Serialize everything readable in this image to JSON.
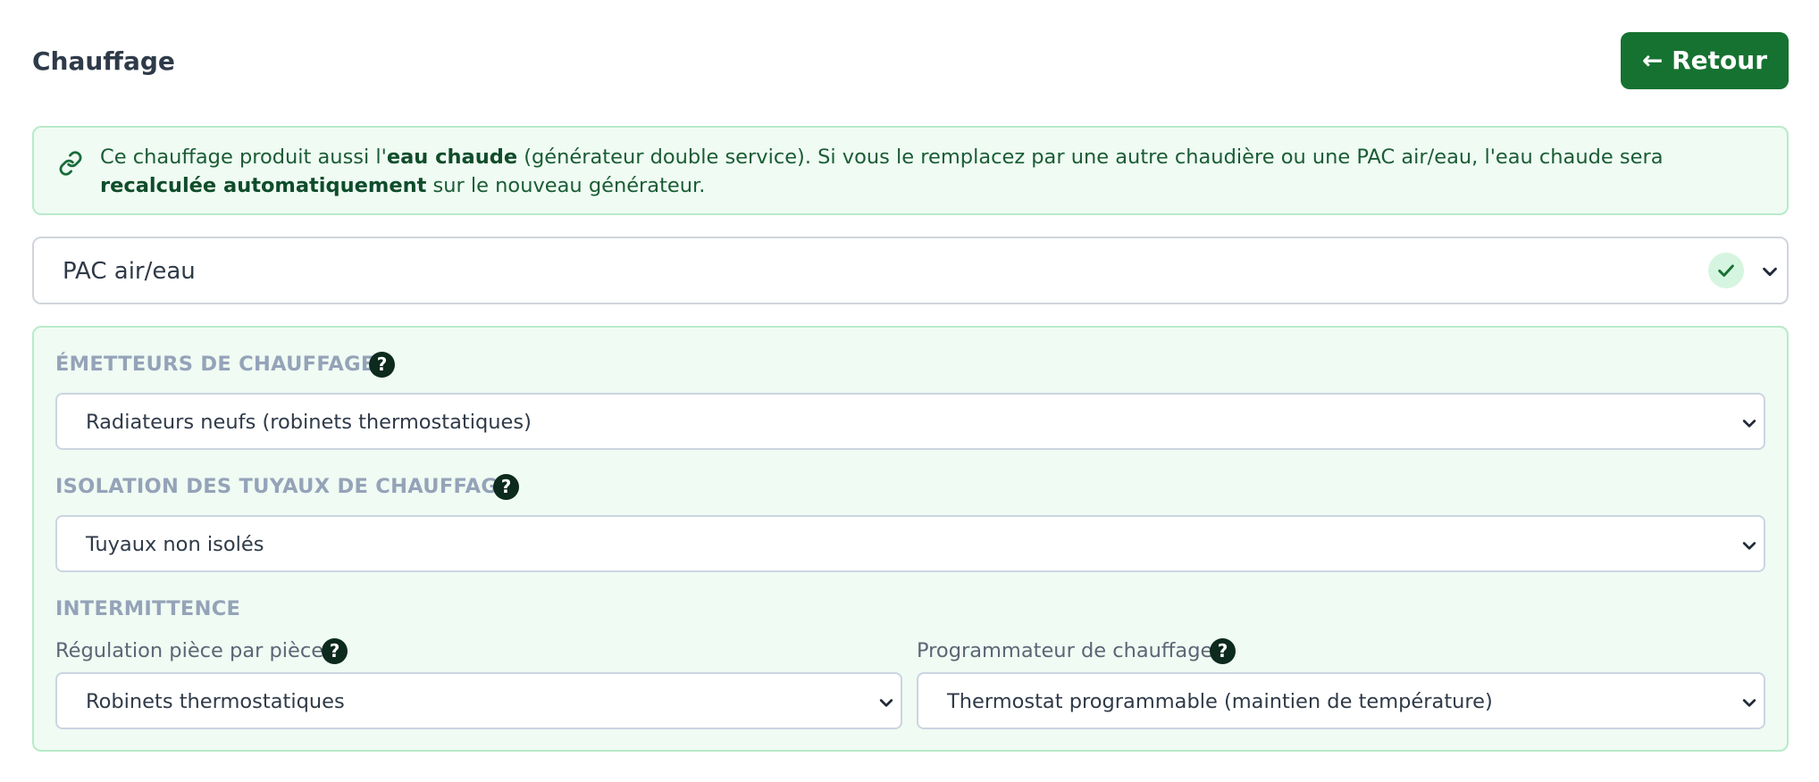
{
  "header": {
    "title": "Chauffage",
    "back_label": "← Retour"
  },
  "notice": {
    "text_1": "Ce chauffage produit aussi l'",
    "bold_1": "eau chaude",
    "text_2": " (générateur double service). Si vous le remplacez par une autre chaudière ou une PAC air/eau, l'eau chaude sera ",
    "bold_2": "recalculée automatiquement",
    "text_3": " sur le nouveau générateur.",
    "icon": "link-icon"
  },
  "generator_select": {
    "value": "PAC air/eau",
    "status_icon": "check-icon"
  },
  "sections": {
    "emitters": {
      "label": "ÉMETTEURS DE CHAUFFAGE",
      "value": "Radiateurs neufs (robinets thermostatiques)"
    },
    "pipe_insulation": {
      "label": "ISOLATION DES TUYAUX DE CHAUFFAGE",
      "value": "Tuyaux non isolés"
    },
    "intermittence": {
      "label": "INTERMITTENCE",
      "regulation": {
        "label": "Régulation pièce par pièce",
        "value": "Robinets thermostatiques"
      },
      "programmer": {
        "label": "Programmateur de chauffage",
        "value": "Thermostat programmable (maintien de température)"
      }
    }
  },
  "help_glyph": "?",
  "colors": {
    "accent": "#167231",
    "panel_bg": "#effbf3",
    "panel_border": "#b8ebc9",
    "label_gray": "#94a3b8",
    "help_bg": "#0c2a1d"
  }
}
